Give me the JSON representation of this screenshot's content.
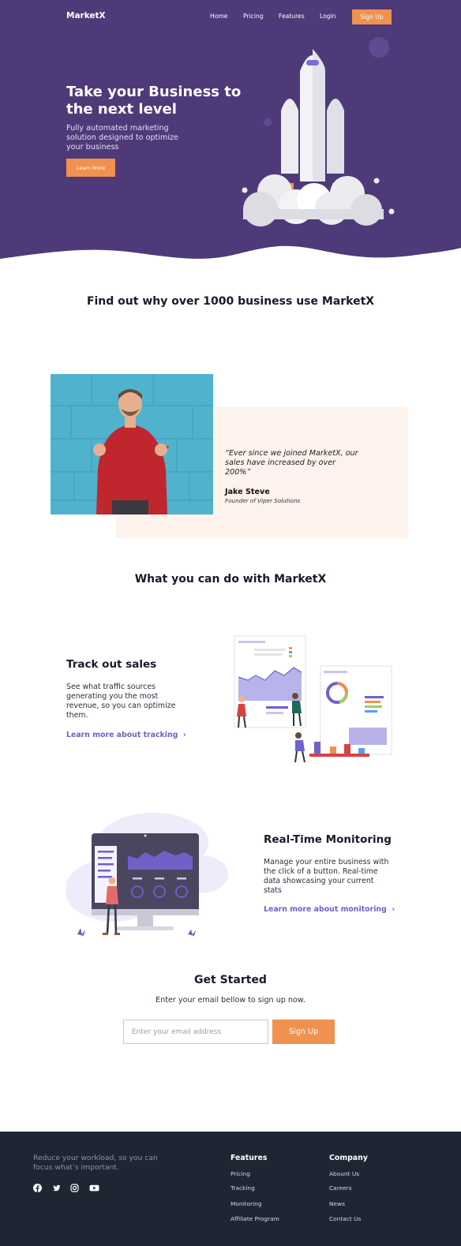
{
  "header": {
    "brand": "MarketX",
    "nav": [
      "Home",
      "Pricing",
      "Features",
      "Login"
    ],
    "signup_label": "Sign Up"
  },
  "hero": {
    "title": "Take your Business to the next level",
    "subtitle": "Fully automated marketing solution designed to optimize your business",
    "cta_label": "Learn More"
  },
  "intro": {
    "title": "Find out why over 1000 business use MarketX"
  },
  "testimonial": {
    "quote": "“Ever since we joined MarketX, our sales have increased by over 200%”",
    "name": "Jake Steve",
    "role": "Founder of Viper Solutions"
  },
  "features": {
    "title": "What you can do with MarketX",
    "items": [
      {
        "title": "Track out sales",
        "description": "See what traffic sources generating you the most revenue, so you can optimize them.",
        "link": "Learn more about tracking"
      },
      {
        "title": "Real-Time Monitoring",
        "description": "Manage your entire business with the click of a button. Real-time data showcasing your current stats",
        "link": "Learn more about monitoring"
      }
    ]
  },
  "get_started": {
    "title": "Get Started",
    "subtitle": "Enter your email bellow to sign up now.",
    "email_placeholder": "Enter your email address",
    "button_label": "Sign Up"
  },
  "footer": {
    "tagline": "Reduce your workload, so you can focus what’s important.",
    "social_icons": [
      "facebook-icon",
      "twitter-icon",
      "instagram-icon",
      "youtube-icon"
    ],
    "columns": [
      {
        "title": "Features",
        "links": [
          "Pricing",
          "Tracking",
          "Monitoring",
          "Affiliate Program"
        ]
      },
      {
        "title": "Company",
        "links": [
          "Abount Us",
          "Careers",
          "News",
          "Contact Us"
        ]
      }
    ]
  },
  "colors": {
    "hero_bg": "#4e3a78",
    "accent": "#f0914f",
    "link": "#7060c8",
    "testimonial_bg": "#fdf2ec",
    "footer_bg": "#1f2633"
  }
}
